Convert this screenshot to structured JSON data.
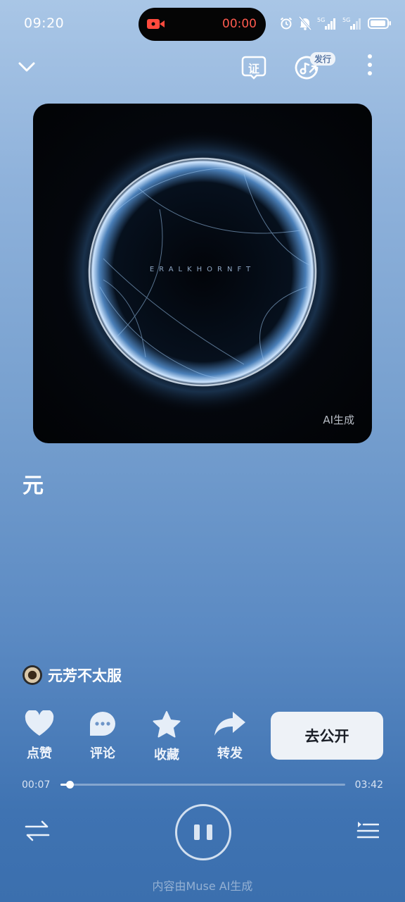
{
  "status_bar": {
    "time": "09:20",
    "record_time": "00:00",
    "icons": [
      "alarm-icon",
      "mute-icon",
      "signal-5g-icon",
      "signal-5g-icon",
      "battery-icon"
    ]
  },
  "header": {
    "back_icon": "chevron-down-icon",
    "cert_label": "证",
    "release_badge": "发行",
    "more_icon": "more-vertical-icon"
  },
  "cover": {
    "art_text": "ERALKHORNFT",
    "ai_badge": "AI生成"
  },
  "song": {
    "title": "元",
    "artist": "元芳不太服"
  },
  "actions": {
    "like": "点赞",
    "comment": "评论",
    "favorite": "收藏",
    "share": "转发",
    "publish": "去公开"
  },
  "player": {
    "elapsed": "00:07",
    "total": "03:42",
    "progress": 0.032
  },
  "footer": {
    "note": "内容由Muse AI生成"
  },
  "colors": {
    "record_red": "#ff5a4e",
    "publish_bg": "#eef2f7"
  }
}
